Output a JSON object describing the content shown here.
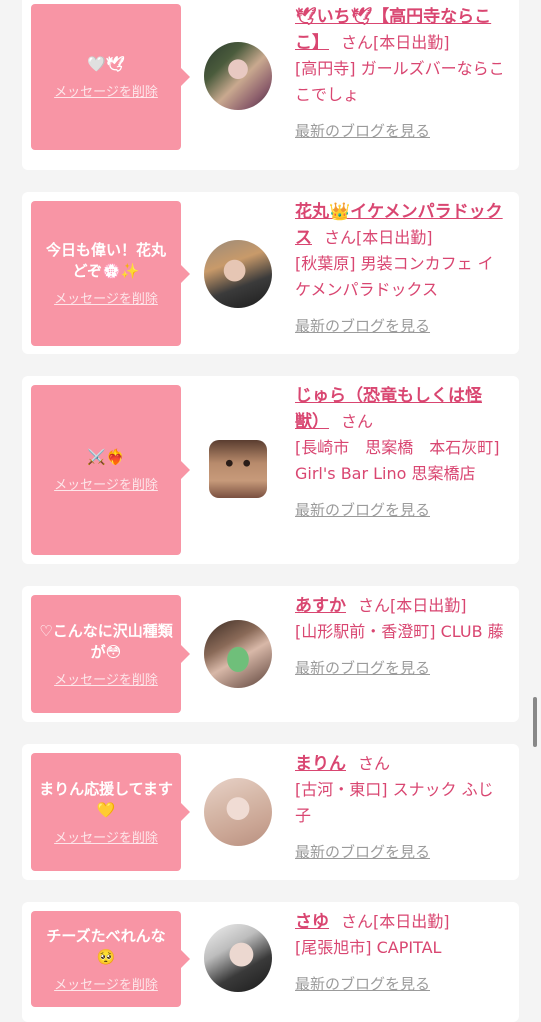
{
  "common": {
    "delete_label": "メッセージを削除",
    "san": "さん",
    "blog_label": "最新のブログを見る"
  },
  "items": [
    {
      "message": "🤍🕊",
      "name": "🕊いち🕊【高円寺ならここ】",
      "status": "[本日出勤]",
      "shop": "[高円寺] ガールズバーならここでしょ"
    },
    {
      "message": "今日も偉い！花丸どぞ💮✨",
      "name": "花丸👑イケメンパラドックス",
      "status": "[本日出勤]",
      "shop": "[秋葉原] 男装コンカフェ イケメンパラドックス"
    },
    {
      "message": "⚔️❤️‍🔥",
      "name": "じゅら（恐竜もしくは怪獣）",
      "status": "",
      "shop": "[長崎市　思案橋　本石灰町] Girl's Bar Lino 思案橋店"
    },
    {
      "message": "♡こんなに沢山種類が😳",
      "name": "あすか",
      "status": "[本日出勤]",
      "shop": "[山形駅前・香澄町] CLUB 藤"
    },
    {
      "message": "まりん応援してます💛",
      "name": "まりん",
      "status": "",
      "shop": "[古河・東口] スナック ふじ子"
    },
    {
      "message": "チーズたべれんな🥺",
      "name": "さゆ",
      "status": "[本日出勤]",
      "shop": "[尾張旭市] CAPITAL"
    }
  ],
  "colors": {
    "bubble": "#f895a5",
    "name": "#d94671",
    "blog": "#9b9b9b",
    "background": "#f4f4f4"
  }
}
